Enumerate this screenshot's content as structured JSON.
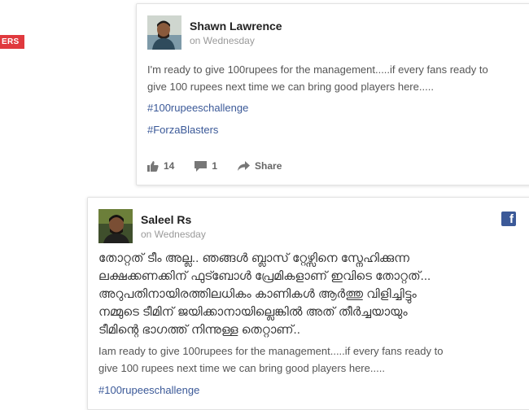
{
  "side_tag": {
    "label": "ERS"
  },
  "posts": [
    {
      "author": "Shawn Lawrence",
      "time": "on Wednesday",
      "lines": [
        "I'm ready to give 100rupees for the management.....if every fans ready to",
        "give 100 rupees next time we can bring good players here....."
      ],
      "hashtags": [
        "#100rupeeschallenge",
        "#ForzaBlasters"
      ],
      "actions": {
        "likes": "14",
        "comments": "1",
        "share_label": "Share"
      }
    },
    {
      "author": "Saleel Rs",
      "time": "on Wednesday",
      "network_icon": "facebook-icon",
      "malayalam_lines": [
        "തോറ്റത് ടീം അല്ല.. ഞങ്ങൾ ബ്ലാസ് റ്റേഴ്സിനെ സ്നേഹിക്കുന്ന",
        "ലക്ഷക്കണക്കിന് ഫുട്ബോൾ പ്രേമികളാണ് ഇവിടെ തോറ്റത്...",
        "അറുപതിനായിരത്തിലധികം കാണികൾ ആർത്തു വിളിച്ചിട്ടും",
        "നമ്മുടെ ടീമിന് ജയിക്കാനായില്ലെങ്കിൽ അത് തീർച്ചയായും",
        "ടീമിന്റെ ഭാഗത്ത് നിന്നുള്ള തെറ്റാണ്.."
      ],
      "lines": [
        "Iam ready to give 100rupees for the management.....if every fans ready to",
        "give 100 rupees next time we can bring good players here....."
      ],
      "hashtags": [
        "#100rupeeschallenge"
      ]
    }
  ],
  "colors": {
    "link": "#3b5998",
    "facebook": "#3b5998",
    "tag": "#e0393e"
  }
}
